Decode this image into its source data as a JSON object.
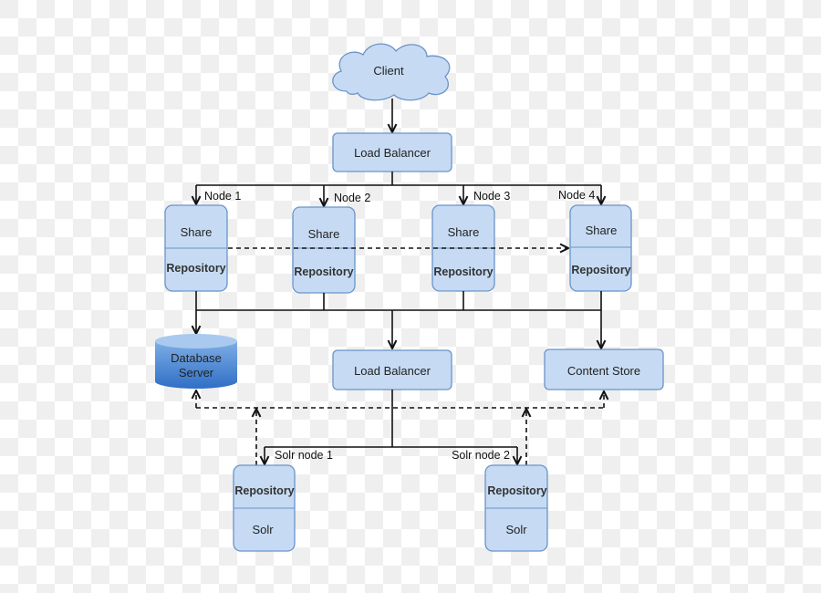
{
  "client": "Client",
  "load_balancer_top": "Load Balancer",
  "nodes": [
    {
      "label": "Node 1",
      "top": "Share",
      "bottom": "Repository"
    },
    {
      "label": "Node 2",
      "top": "Share",
      "bottom": "Repository"
    },
    {
      "label": "Node 3",
      "top": "Share",
      "bottom": "Repository"
    },
    {
      "label": "Node 4",
      "top": "Share",
      "bottom": "Repository"
    }
  ],
  "database": {
    "line1": "Database",
    "line2": "Server"
  },
  "load_balancer_bottom": "Load Balancer",
  "content_store": "Content Store",
  "solr_nodes": [
    {
      "label": "Solr node 1",
      "top": "Repository",
      "bottom": "Solr"
    },
    {
      "label": "Solr node 2",
      "top": "Repository",
      "bottom": "Solr"
    }
  ],
  "colors": {
    "box_fill": "#c6dbf3",
    "box_stroke": "#6a93c9",
    "database": "#3f7fd1"
  }
}
